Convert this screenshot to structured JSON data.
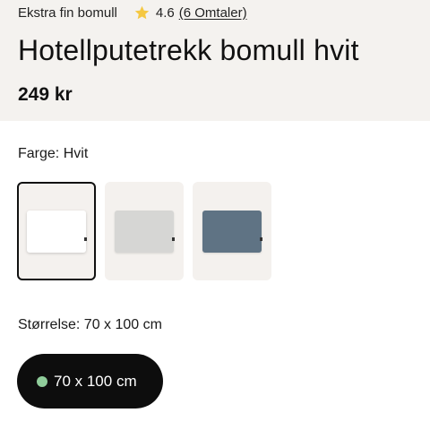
{
  "product": {
    "subtitle": "Ekstra fin bomull",
    "rating": "4.6",
    "reviews_link": "(6 Omtaler)",
    "title": "Hotellputetrekk bomull hvit",
    "price": "249 kr"
  },
  "color_option": {
    "label": "Farge:",
    "selected_value": "Hvit",
    "swatches": [
      {
        "name": "white",
        "color": "#ffffff",
        "selected": true
      },
      {
        "name": "light-grey",
        "color": "#d6d6d4",
        "selected": false
      },
      {
        "name": "blue-grey",
        "color": "#5f7384",
        "selected": false
      }
    ]
  },
  "size_option": {
    "label": "Størrelse:",
    "selected_value": "70 x 100 cm",
    "chip_label": "70 x 100 cm",
    "availability_color": "#8fcc9a"
  },
  "colors": {
    "star": "#f5c842",
    "band_background": "#f4f2ef",
    "chip_background": "#0d0d0d"
  }
}
